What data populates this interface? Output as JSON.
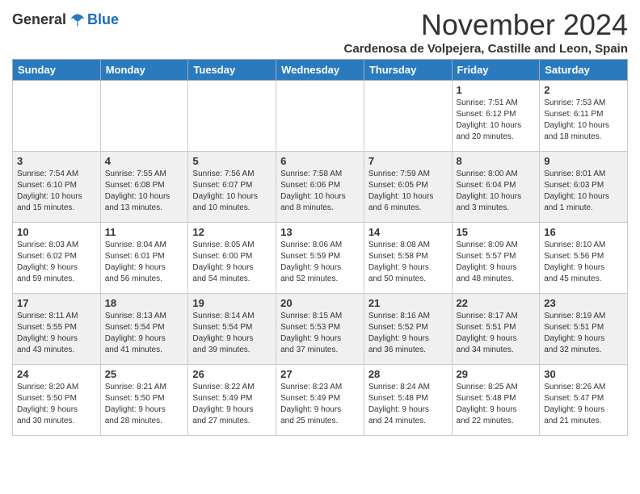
{
  "header": {
    "logo_general": "General",
    "logo_blue": "Blue",
    "month_title": "November 2024",
    "location": "Cardenosa de Volpejera, Castille and Leon, Spain"
  },
  "weekdays": [
    "Sunday",
    "Monday",
    "Tuesday",
    "Wednesday",
    "Thursday",
    "Friday",
    "Saturday"
  ],
  "weeks": [
    [
      {
        "day": "",
        "info": ""
      },
      {
        "day": "",
        "info": ""
      },
      {
        "day": "",
        "info": ""
      },
      {
        "day": "",
        "info": ""
      },
      {
        "day": "",
        "info": ""
      },
      {
        "day": "1",
        "info": "Sunrise: 7:51 AM\nSunset: 6:12 PM\nDaylight: 10 hours\nand 20 minutes."
      },
      {
        "day": "2",
        "info": "Sunrise: 7:53 AM\nSunset: 6:11 PM\nDaylight: 10 hours\nand 18 minutes."
      }
    ],
    [
      {
        "day": "3",
        "info": "Sunrise: 7:54 AM\nSunset: 6:10 PM\nDaylight: 10 hours\nand 15 minutes."
      },
      {
        "day": "4",
        "info": "Sunrise: 7:55 AM\nSunset: 6:08 PM\nDaylight: 10 hours\nand 13 minutes."
      },
      {
        "day": "5",
        "info": "Sunrise: 7:56 AM\nSunset: 6:07 PM\nDaylight: 10 hours\nand 10 minutes."
      },
      {
        "day": "6",
        "info": "Sunrise: 7:58 AM\nSunset: 6:06 PM\nDaylight: 10 hours\nand 8 minutes."
      },
      {
        "day": "7",
        "info": "Sunrise: 7:59 AM\nSunset: 6:05 PM\nDaylight: 10 hours\nand 6 minutes."
      },
      {
        "day": "8",
        "info": "Sunrise: 8:00 AM\nSunset: 6:04 PM\nDaylight: 10 hours\nand 3 minutes."
      },
      {
        "day": "9",
        "info": "Sunrise: 8:01 AM\nSunset: 6:03 PM\nDaylight: 10 hours\nand 1 minute."
      }
    ],
    [
      {
        "day": "10",
        "info": "Sunrise: 8:03 AM\nSunset: 6:02 PM\nDaylight: 9 hours\nand 59 minutes."
      },
      {
        "day": "11",
        "info": "Sunrise: 8:04 AM\nSunset: 6:01 PM\nDaylight: 9 hours\nand 56 minutes."
      },
      {
        "day": "12",
        "info": "Sunrise: 8:05 AM\nSunset: 6:00 PM\nDaylight: 9 hours\nand 54 minutes."
      },
      {
        "day": "13",
        "info": "Sunrise: 8:06 AM\nSunset: 5:59 PM\nDaylight: 9 hours\nand 52 minutes."
      },
      {
        "day": "14",
        "info": "Sunrise: 8:08 AM\nSunset: 5:58 PM\nDaylight: 9 hours\nand 50 minutes."
      },
      {
        "day": "15",
        "info": "Sunrise: 8:09 AM\nSunset: 5:57 PM\nDaylight: 9 hours\nand 48 minutes."
      },
      {
        "day": "16",
        "info": "Sunrise: 8:10 AM\nSunset: 5:56 PM\nDaylight: 9 hours\nand 45 minutes."
      }
    ],
    [
      {
        "day": "17",
        "info": "Sunrise: 8:11 AM\nSunset: 5:55 PM\nDaylight: 9 hours\nand 43 minutes."
      },
      {
        "day": "18",
        "info": "Sunrise: 8:13 AM\nSunset: 5:54 PM\nDaylight: 9 hours\nand 41 minutes."
      },
      {
        "day": "19",
        "info": "Sunrise: 8:14 AM\nSunset: 5:54 PM\nDaylight: 9 hours\nand 39 minutes."
      },
      {
        "day": "20",
        "info": "Sunrise: 8:15 AM\nSunset: 5:53 PM\nDaylight: 9 hours\nand 37 minutes."
      },
      {
        "day": "21",
        "info": "Sunrise: 8:16 AM\nSunset: 5:52 PM\nDaylight: 9 hours\nand 36 minutes."
      },
      {
        "day": "22",
        "info": "Sunrise: 8:17 AM\nSunset: 5:51 PM\nDaylight: 9 hours\nand 34 minutes."
      },
      {
        "day": "23",
        "info": "Sunrise: 8:19 AM\nSunset: 5:51 PM\nDaylight: 9 hours\nand 32 minutes."
      }
    ],
    [
      {
        "day": "24",
        "info": "Sunrise: 8:20 AM\nSunset: 5:50 PM\nDaylight: 9 hours\nand 30 minutes."
      },
      {
        "day": "25",
        "info": "Sunrise: 8:21 AM\nSunset: 5:50 PM\nDaylight: 9 hours\nand 28 minutes."
      },
      {
        "day": "26",
        "info": "Sunrise: 8:22 AM\nSunset: 5:49 PM\nDaylight: 9 hours\nand 27 minutes."
      },
      {
        "day": "27",
        "info": "Sunrise: 8:23 AM\nSunset: 5:49 PM\nDaylight: 9 hours\nand 25 minutes."
      },
      {
        "day": "28",
        "info": "Sunrise: 8:24 AM\nSunset: 5:48 PM\nDaylight: 9 hours\nand 24 minutes."
      },
      {
        "day": "29",
        "info": "Sunrise: 8:25 AM\nSunset: 5:48 PM\nDaylight: 9 hours\nand 22 minutes."
      },
      {
        "day": "30",
        "info": "Sunrise: 8:26 AM\nSunset: 5:47 PM\nDaylight: 9 hours\nand 21 minutes."
      }
    ]
  ]
}
